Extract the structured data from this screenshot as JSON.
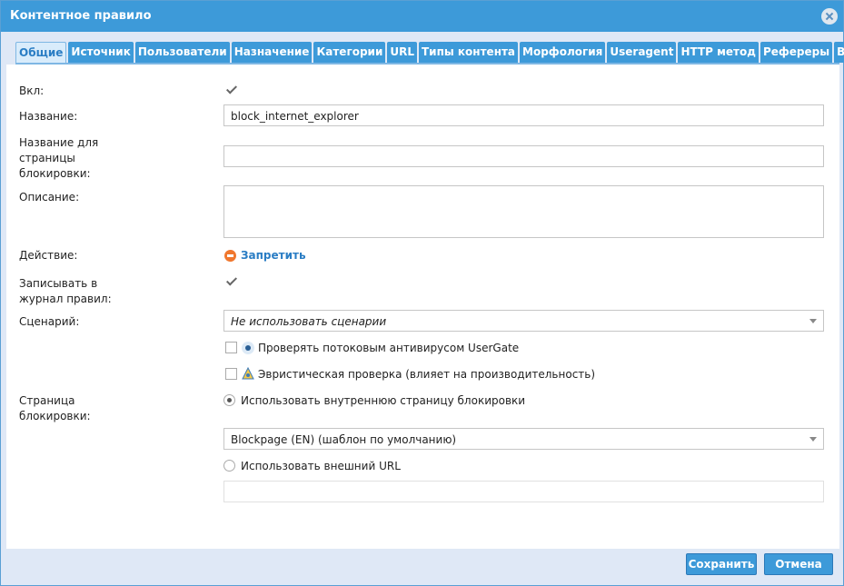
{
  "dialog": {
    "title": "Контентное правило"
  },
  "tabs": [
    {
      "label": "Общие",
      "active": true
    },
    {
      "label": "Источник"
    },
    {
      "label": "Пользователи"
    },
    {
      "label": "Назначение"
    },
    {
      "label": "Категории"
    },
    {
      "label": "URL"
    },
    {
      "label": "Типы контента"
    },
    {
      "label": "Морфология"
    },
    {
      "label": "Useragent"
    },
    {
      "label": "HTTP метод"
    },
    {
      "label": "Рефереры"
    },
    {
      "label": "Время"
    }
  ],
  "form": {
    "enabled": {
      "label": "Вкл:",
      "checked": true
    },
    "name": {
      "label": "Название:",
      "value": "block_internet_explorer"
    },
    "block_page_name": {
      "label_lines": [
        "Название для",
        "страницы",
        "блокировки:"
      ],
      "value": ""
    },
    "description": {
      "label": "Описание:",
      "value": ""
    },
    "action": {
      "label": "Действие:",
      "value": "Запретить"
    },
    "log": {
      "label_lines": [
        "Записывать в",
        "журнал правил:"
      ],
      "checked": true
    },
    "scenario": {
      "label": "Сценарий:",
      "value": "Не использовать сценарии"
    },
    "antivirus": {
      "label": "Проверять потоковым антивирусом UserGate",
      "checked": false
    },
    "heuristic": {
      "label": "Эвристическая проверка (влияет на производительность)",
      "checked": false
    },
    "block_page": {
      "label_lines": [
        "Страница",
        "блокировки:"
      ],
      "internal": {
        "label": "Использовать внутреннюю страницу блокировки",
        "selected": true
      },
      "template": "Blockpage (EN) (шаблон по умолчанию)",
      "external": {
        "label": "Использовать внешний URL",
        "selected": false
      },
      "external_url": ""
    }
  },
  "buttons": {
    "save": "Сохранить",
    "cancel": "Отмена"
  },
  "colors": {
    "accent": "#3d9ad9",
    "deny": "#f0772e",
    "link": "#2a7dc4"
  }
}
